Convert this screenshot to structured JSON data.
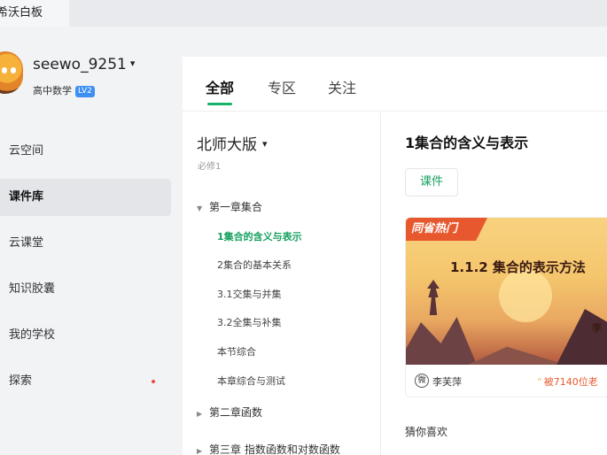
{
  "app": {
    "title": "希沃白板"
  },
  "user": {
    "name": "seewo_9251",
    "subject": "高中数学",
    "level": "LV2"
  },
  "nav": {
    "items": [
      {
        "label": "云空间"
      },
      {
        "label": "课件库",
        "active": true
      },
      {
        "label": "云课堂"
      },
      {
        "label": "知识胶囊"
      },
      {
        "label": "我的学校"
      },
      {
        "label": "探索",
        "has_dot": true
      }
    ]
  },
  "tabs": [
    {
      "label": "全部",
      "active": true
    },
    {
      "label": "专区"
    },
    {
      "label": "关注"
    }
  ],
  "tree": {
    "edition": "北师大版",
    "volume": "必修1",
    "chapters": [
      {
        "label": "第一章集合",
        "expanded": true,
        "lessons": [
          {
            "label": "1集合的含义与表示",
            "active": true
          },
          {
            "label": "2集合的基本关系"
          },
          {
            "label": "3.1交集与并集"
          },
          {
            "label": "3.2全集与补集"
          },
          {
            "label": "本节综合"
          },
          {
            "label": "本章综合与测试"
          }
        ]
      },
      {
        "label": "第二章函数"
      },
      {
        "label": "第三章 指数函数和对数函数"
      }
    ]
  },
  "detail": {
    "title": "1集合的含义与表示",
    "type_badge": "课件",
    "card": {
      "hot_label": "同省热门",
      "thumb_title": "1.1.2 集合的表示方法",
      "thumb_author": "李",
      "author_glyph": "微",
      "author": "李芙萍",
      "usage": "被7140位老"
    },
    "guess_label": "猜你喜欢"
  },
  "colors": {
    "accent": "#16b36b",
    "hot": "#e8582e",
    "level_badge": "#3d8ff3"
  }
}
